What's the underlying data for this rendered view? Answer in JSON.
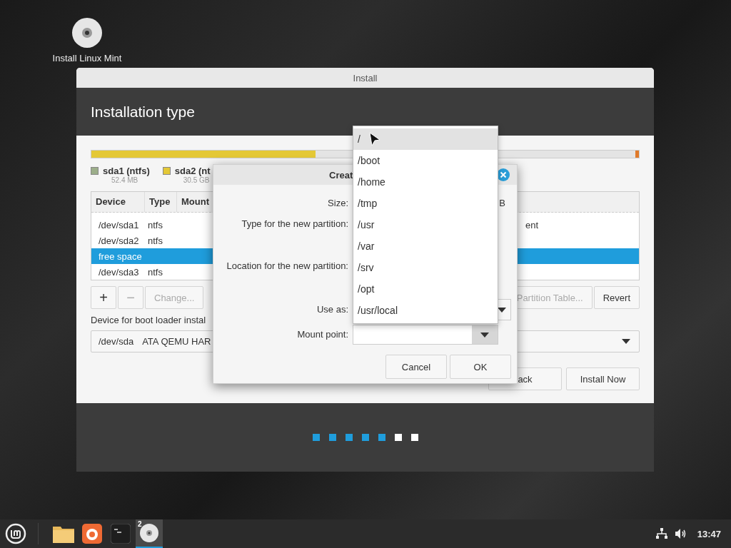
{
  "desktop_icons": [
    {
      "label": "Install Linux Mint"
    }
  ],
  "window": {
    "title": "Install",
    "heading": "Installation type",
    "partition_bar": {
      "level": 0.41
    },
    "legend": [
      {
        "name": "sda1 (ntfs)",
        "size": "52.4 MB",
        "color": "#9cae8a"
      },
      {
        "name": "sda2 (nt",
        "size": "30.5 GB",
        "color": "#e4c836"
      }
    ],
    "table": {
      "columns": [
        "Device",
        "Type",
        "Mount"
      ],
      "rows": [
        {
          "device": "/dev/sda1",
          "type": "ntfs",
          "tail": "ent",
          "selected": false
        },
        {
          "device": "/dev/sda2",
          "type": "ntfs",
          "selected": false
        },
        {
          "device": "free space",
          "selected": true
        },
        {
          "device": "/dev/sda3",
          "type": "ntfs",
          "selected": false
        }
      ]
    },
    "partition_buttons": [
      {
        "label": "+",
        "disabled": false
      },
      {
        "label": "−",
        "disabled": true
      },
      {
        "label": "Change...",
        "disabled": true
      }
    ],
    "table_buttons": [
      {
        "label": "Partition Table...",
        "disabled": true
      },
      {
        "label": "Revert",
        "disabled": false
      }
    ],
    "boot_loader": {
      "label": "Device for boot loader instal",
      "device": "/dev/sda",
      "model": "ATA QEMU HAR"
    },
    "nav_buttons": [
      {
        "label": "ack"
      },
      {
        "label": "Install Now"
      }
    ],
    "steps": [
      {
        "done": true
      },
      {
        "done": true
      },
      {
        "done": true
      },
      {
        "done": true
      },
      {
        "done": true
      },
      {
        "done": false
      },
      {
        "done": false
      }
    ]
  },
  "dialog": {
    "title": "Creat",
    "labels": [
      "Size:",
      "Type for the new partition:",
      "Location for the new partition:",
      "Use as:",
      "Mount point:"
    ],
    "size_unit": "B",
    "buttons": [
      "Cancel",
      "OK"
    ]
  },
  "dropdown": {
    "items": [
      {
        "label": "/",
        "selected": true
      },
      {
        "label": "/boot",
        "selected": false
      },
      {
        "label": "/home",
        "selected": false
      },
      {
        "label": "/tmp",
        "selected": false
      },
      {
        "label": "/usr",
        "selected": false
      },
      {
        "label": "/var",
        "selected": false
      },
      {
        "label": "/srv",
        "selected": false
      },
      {
        "label": "/opt",
        "selected": false
      },
      {
        "label": "/usr/local",
        "selected": false
      }
    ]
  },
  "taskbar": {
    "apps": [
      {
        "kind": "folder",
        "active": false
      },
      {
        "kind": "browser",
        "active": false
      },
      {
        "kind": "terminal",
        "active": false
      },
      {
        "kind": "disc",
        "active": true,
        "count": "2"
      }
    ],
    "clock": "13:47"
  }
}
